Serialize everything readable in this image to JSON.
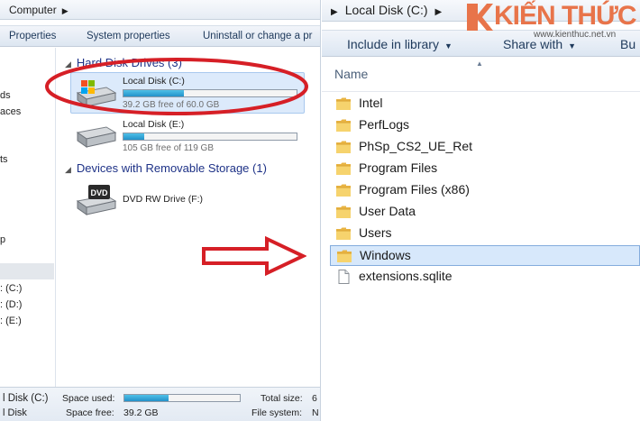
{
  "left": {
    "address": "Computer",
    "toolbar": {
      "properties": "Properties",
      "system_properties": "System properties",
      "uninstall": "Uninstall or change a pr"
    },
    "nav": [
      "ds",
      "aces",
      "ts",
      "p",
      ": (C:)",
      ": (D:)",
      ": (E:)"
    ],
    "hard_disk_group": "Hard Disk Drives (3)",
    "removable_group": "Devices with Removable Storage (1)",
    "drives": [
      {
        "name": "Local Disk (C:)",
        "free": "39.2 GB free of 60.0 GB",
        "used_fraction": 0.35
      },
      {
        "name": "Local Disk (E:)",
        "free": "105 GB free of 119 GB",
        "used_fraction": 0.12
      }
    ],
    "dvd": {
      "name": "DVD RW Drive (F:)",
      "icon_label": "DVD"
    },
    "status": {
      "disk_name": "l Disk (C:)",
      "disk_type": "l Disk",
      "space_used_label": "Space used:",
      "space_free_label": "Space free:",
      "space_free_value": "39.2 GB",
      "total_size_label": "Total size:",
      "total_size_value": "6",
      "file_system_label": "File system:",
      "file_system_value": "N",
      "used_fraction": 0.38
    }
  },
  "right": {
    "address": "Local Disk (C:)",
    "toolbar": {
      "include_in_library": "Include in library",
      "share_with": "Share with",
      "burn": "Bu"
    },
    "column_name": "Name",
    "items": [
      {
        "name": "Intel",
        "type": "folder",
        "selected": false
      },
      {
        "name": "PerfLogs",
        "type": "folder",
        "selected": false
      },
      {
        "name": "PhSp_CS2_UE_Ret",
        "type": "folder",
        "selected": false
      },
      {
        "name": "Program Files",
        "type": "folder",
        "selected": false
      },
      {
        "name": "Program Files (x86)",
        "type": "folder",
        "selected": false
      },
      {
        "name": "User Data",
        "type": "folder",
        "selected": false
      },
      {
        "name": "Users",
        "type": "folder",
        "selected": false
      },
      {
        "name": "Windows",
        "type": "folder",
        "selected": true
      },
      {
        "name": "extensions.sqlite",
        "type": "file",
        "selected": false
      }
    ]
  },
  "watermark": {
    "brand": "KIẾN THỨC",
    "url": "www.kienthuc.net.vn"
  },
  "colors": {
    "annotation_red": "#d61f26",
    "folder": "#f3c75a",
    "selection": "#d7e8fb",
    "usage_bar": "#2a9bd2",
    "brand": "#e8744a"
  },
  "icons": {
    "folder": "folder-icon",
    "file": "file-icon",
    "hard_disk": "hard-disk-icon",
    "dvd": "dvd-drive-icon"
  }
}
